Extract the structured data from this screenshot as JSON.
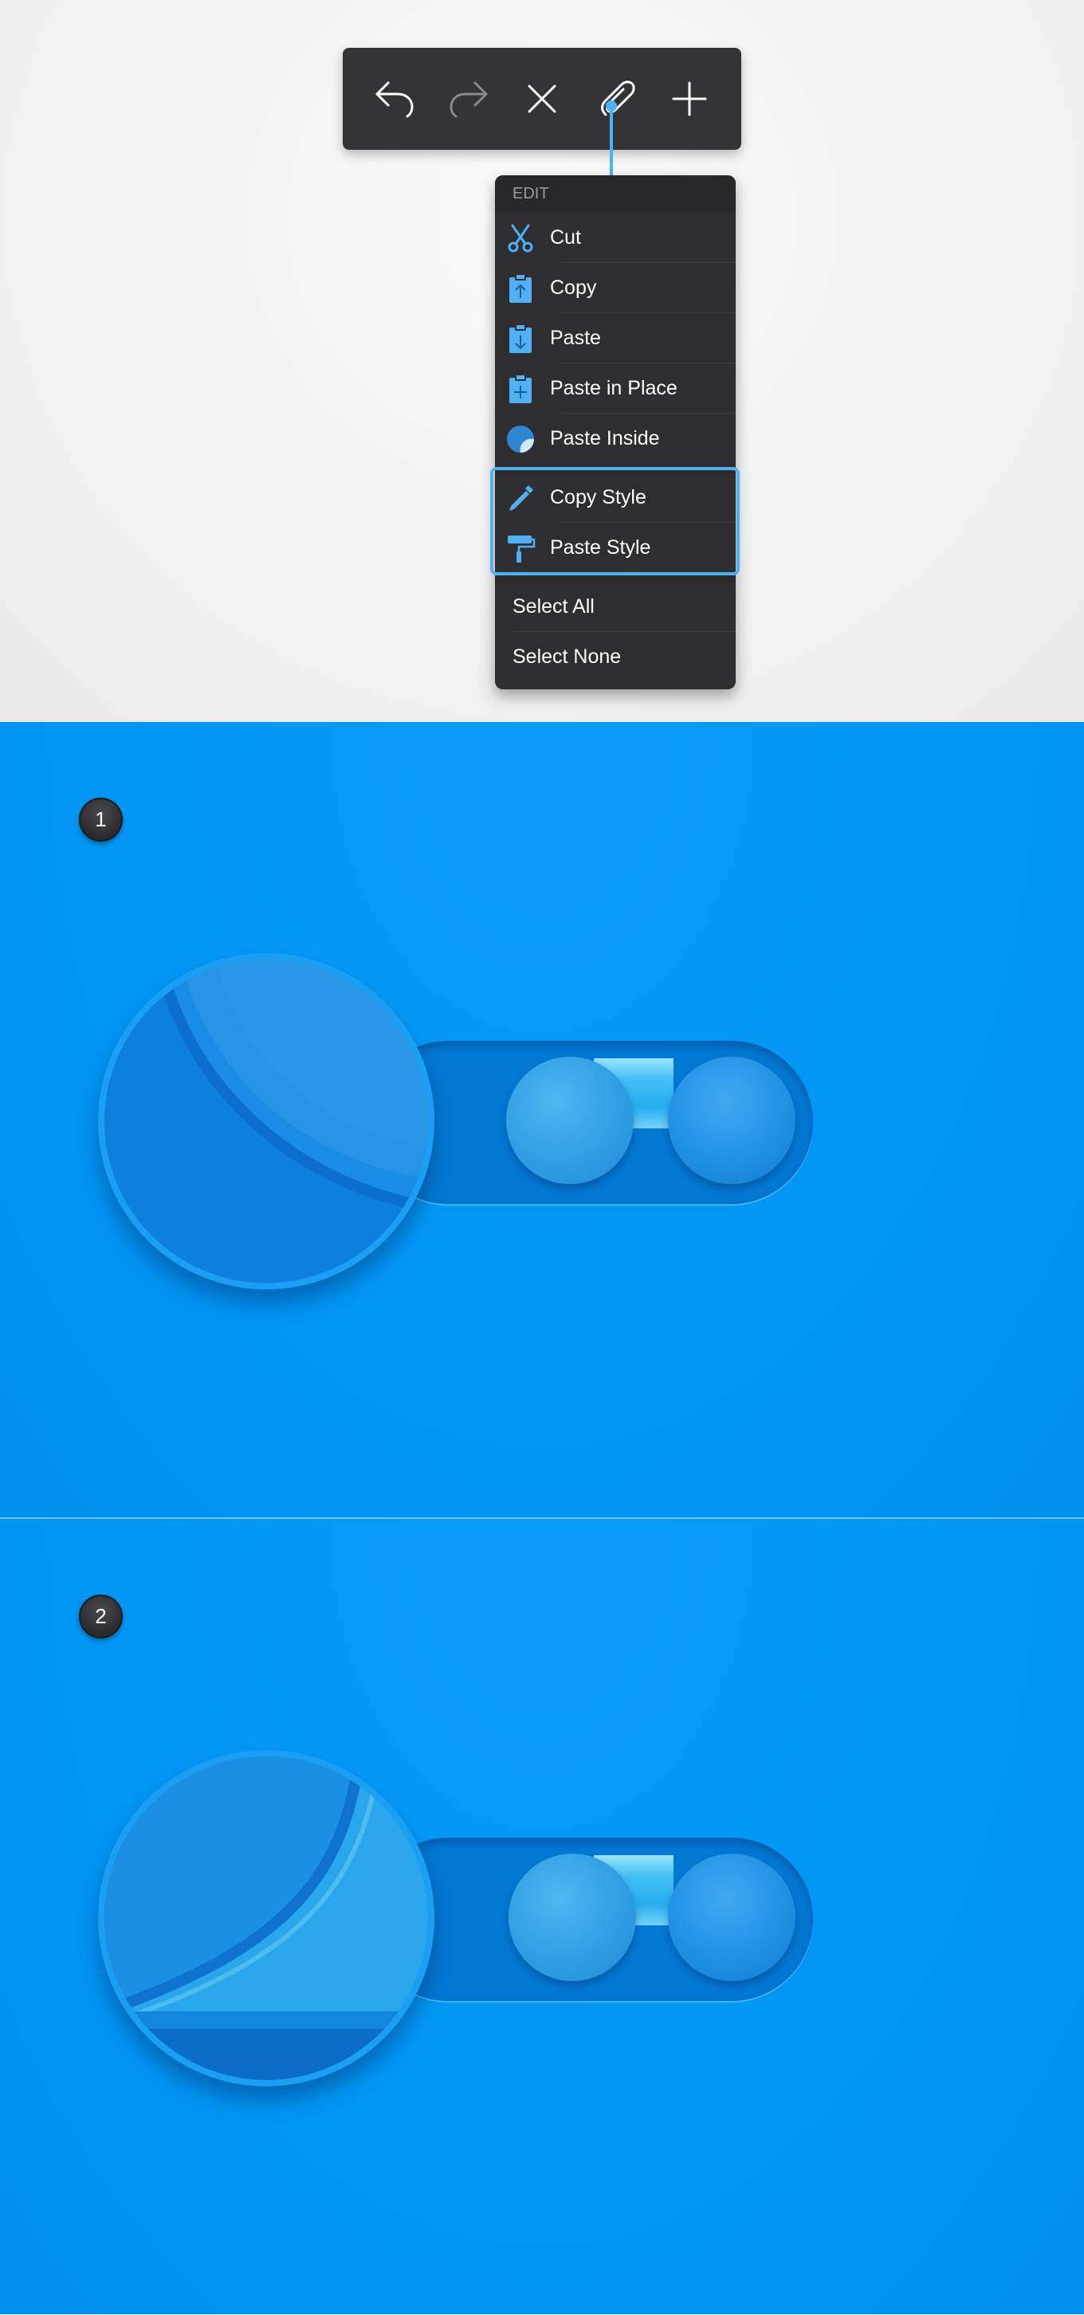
{
  "toolbar": {
    "buttons": [
      {
        "name": "undo",
        "icon": "undo-arrow-icon",
        "enabled": true
      },
      {
        "name": "redo",
        "icon": "redo-arrow-icon",
        "enabled": false
      },
      {
        "name": "close",
        "icon": "close-x-icon",
        "enabled": true
      },
      {
        "name": "paperclip",
        "icon": "paperclip-icon",
        "enabled": true
      },
      {
        "name": "add",
        "icon": "plus-icon",
        "enabled": true
      }
    ]
  },
  "edit_menu": {
    "header": "EDIT",
    "items": [
      {
        "label": "Cut",
        "icon": "scissors-icon"
      },
      {
        "label": "Copy",
        "icon": "clipboard-copy-icon"
      },
      {
        "label": "Paste",
        "icon": "clipboard-paste-icon"
      },
      {
        "label": "Paste in Place",
        "icon": "clipboard-plus-icon"
      },
      {
        "label": "Paste Inside",
        "icon": "circle-mask-icon"
      }
    ],
    "style_items": [
      {
        "label": "Copy Style",
        "icon": "eyedropper-icon"
      },
      {
        "label": "Paste Style",
        "icon": "paint-roller-icon"
      }
    ],
    "selection_items": [
      {
        "label": "Select All"
      },
      {
        "label": "Select None"
      }
    ],
    "highlighted_group": "style_items"
  },
  "steps": [
    {
      "number": "1"
    },
    {
      "number": "2"
    }
  ],
  "colors": {
    "background_blue": "#0196f4",
    "accent_blue": "#4fb1f3",
    "menu_dark": "#2e2e30",
    "toolbar_dark": "#343436"
  }
}
